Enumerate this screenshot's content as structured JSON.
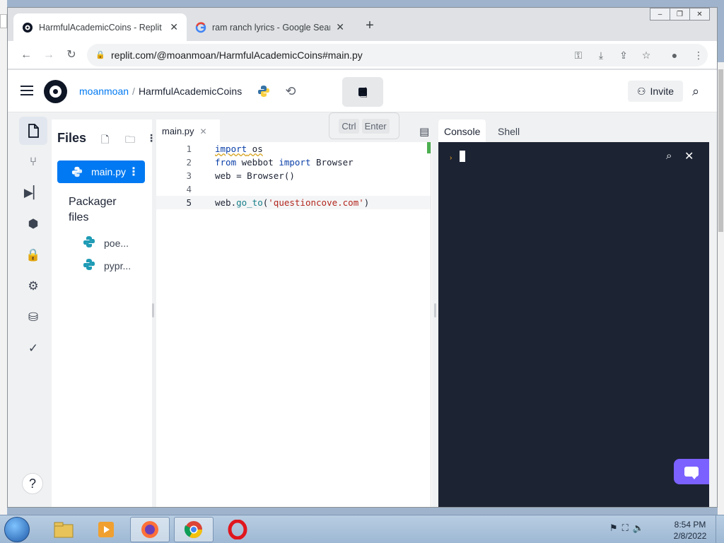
{
  "browser": {
    "tabs": [
      {
        "title": "HarmfulAcademicCoins - Replit",
        "active": true
      },
      {
        "title": "ram ranch lyrics - Google Search",
        "active": false
      }
    ],
    "new_tab": "+",
    "window_controls": [
      "–",
      "❐",
      "✕"
    ],
    "url": "replit.com/@moanmoan/HarmfulAcademicCoins#main.py"
  },
  "header": {
    "user": "moanmoan",
    "separator": "/",
    "repl_name": "HarmfulAcademicCoins",
    "invite_label": "Invite"
  },
  "tooltip": {
    "key1": "Ctrl",
    "key2": "Enter"
  },
  "files": {
    "title": "Files",
    "items": [
      {
        "name": "main.py",
        "selected": true
      }
    ],
    "packager_title": "Packager files",
    "packager_items": [
      {
        "name": "poe..."
      },
      {
        "name": "pypr..."
      }
    ]
  },
  "editor": {
    "tab_label": "main.py",
    "lines": [
      {
        "n": "1"
      },
      {
        "n": "2"
      },
      {
        "n": "3"
      },
      {
        "n": "4"
      },
      {
        "n": "5"
      }
    ],
    "code": {
      "l1_kw": "import",
      "l1_rest": " os",
      "l2_kw1": "from",
      "l2_mod": " webbot ",
      "l2_kw2": "import",
      "l2_rest": " Browser",
      "l3": "web = Browser()",
      "l5_obj": "web.",
      "l5_fn": "go_to",
      "l5_open": "(",
      "l5_str": "'questioncove.com'",
      "l5_close": ")"
    }
  },
  "console": {
    "tabs": [
      {
        "label": "Console",
        "active": true
      },
      {
        "label": "Shell",
        "active": false
      }
    ],
    "prompt": "›"
  },
  "taskbar": {
    "time": "8:54 PM",
    "date": "2/8/2022"
  },
  "colors": {
    "accent": "#0079f2",
    "console_bg": "#1c2333",
    "chat_button": "#7b61ff"
  }
}
